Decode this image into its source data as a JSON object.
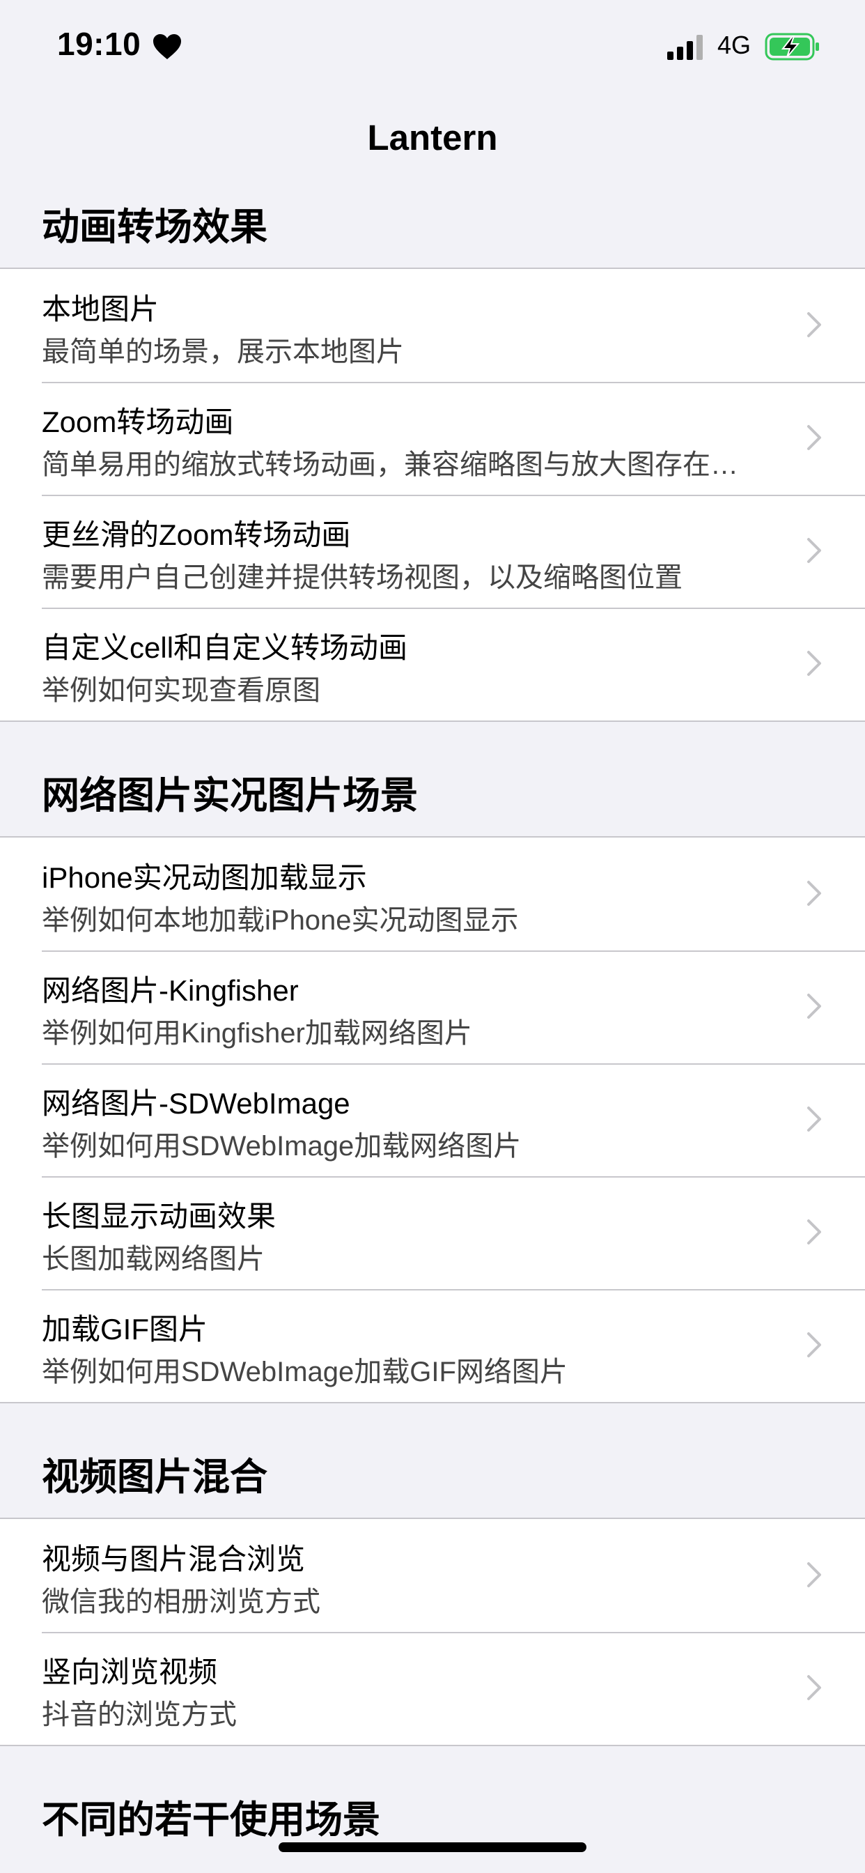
{
  "status_bar": {
    "time": "19:10",
    "network": "4G",
    "icons": [
      "heart-icon",
      "signal-icon",
      "battery-charging-icon"
    ],
    "battery_color": "#34c759"
  },
  "nav": {
    "title": "Lantern"
  },
  "sections": [
    {
      "title": "动画转场效果",
      "rows": [
        {
          "title": "本地图片",
          "subtitle": "最简单的场景，展示本地图片"
        },
        {
          "title": "Zoom转场动画",
          "subtitle": "简单易用的缩放式转场动画，兼容缩略图与放大图存在不同比例的情况"
        },
        {
          "title": "更丝滑的Zoom转场动画",
          "subtitle": "需要用户自己创建并提供转场视图，以及缩略图位置"
        },
        {
          "title": "自定义cell和自定义转场动画",
          "subtitle": "举例如何实现查看原图"
        }
      ]
    },
    {
      "title": "网络图片实况图片场景",
      "rows": [
        {
          "title": "iPhone实况动图加载显示",
          "subtitle": "举例如何本地加载iPhone实况动图显示"
        },
        {
          "title": "网络图片-Kingfisher",
          "subtitle": "举例如何用Kingfisher加载网络图片"
        },
        {
          "title": "网络图片-SDWebImage",
          "subtitle": "举例如何用SDWebImage加载网络图片"
        },
        {
          "title": "长图显示动画效果",
          "subtitle": "长图加载网络图片"
        },
        {
          "title": "加载GIF图片",
          "subtitle": "举例如何用SDWebImage加载GIF网络图片"
        }
      ]
    },
    {
      "title": "视频图片混合",
      "rows": [
        {
          "title": "视频与图片混合浏览",
          "subtitle": "微信我的相册浏览方式"
        },
        {
          "title": "竖向浏览视频",
          "subtitle": "抖音的浏览方式"
        }
      ]
    },
    {
      "title": "不同的若干使用场景",
      "rows": []
    }
  ]
}
